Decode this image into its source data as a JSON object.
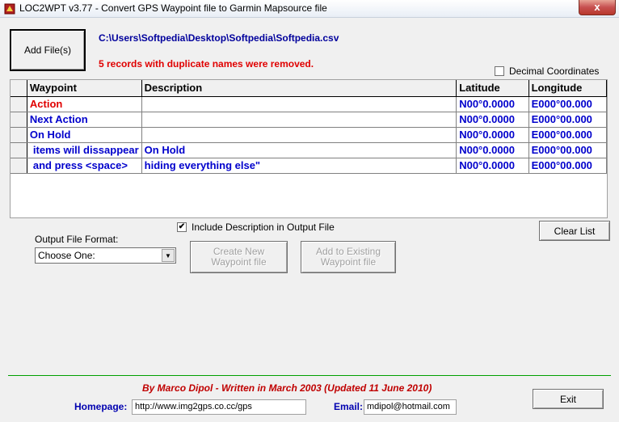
{
  "window": {
    "title": "LOC2WPT v3.77 - Convert GPS Waypoint file to Garmin Mapsource file",
    "close_glyph": "x"
  },
  "toolbar": {
    "add_files_label": "Add File(s)",
    "file_path": "C:\\Users\\Softpedia\\Desktop\\Softpedia\\Softpedia.csv",
    "duplicates_message": "5 records with duplicate names were removed."
  },
  "options": {
    "decimal_coordinates_label": "Decimal Coordinates",
    "decimal_coordinates_checked": false,
    "include_description_label": "Include Description in Output File",
    "include_description_checked": true,
    "check_glyph": "✔"
  },
  "grid": {
    "columns": [
      "Waypoint",
      "Description",
      "Latitude",
      "Longitude"
    ],
    "rows": [
      {
        "waypoint": "Action",
        "description": "",
        "latitude": "N00°0.0000",
        "longitude": "E000°00.000"
      },
      {
        "waypoint": "Next Action",
        "description": "",
        "latitude": "N00°0.0000",
        "longitude": "E000°00.000"
      },
      {
        "waypoint": "On Hold",
        "description": "",
        "latitude": "N00°0.0000",
        "longitude": "E000°00.000"
      },
      {
        "waypoint": "items will dissappear",
        "description": "On Hold",
        "latitude": "N00°0.0000",
        "longitude": "E000°00.000"
      },
      {
        "waypoint": "and press <space>",
        "description": "hiding everything else\"",
        "latitude": "N00°0.0000",
        "longitude": "E000°00.000"
      }
    ]
  },
  "output": {
    "format_label": "Output File Format:",
    "format_value": "Choose One:",
    "create_new_label": "Create New Waypoint file",
    "add_existing_label": "Add to Existing Waypoint file",
    "clear_list_label": "Clear List"
  },
  "footer": {
    "credits": "By Marco Dipol  -  Written in March 2003    (Updated 11 June 2010)",
    "homepage_label": "Homepage:",
    "homepage_value": "http://www.img2gps.co.cc/gps",
    "email_label": "Email:",
    "email_value": "mdipol@hotmail.com",
    "exit_label": "Exit"
  },
  "colors": {
    "waypoint_blue": "#0000cc",
    "alert_red": "#e00000",
    "separator_green": "#00a000"
  }
}
